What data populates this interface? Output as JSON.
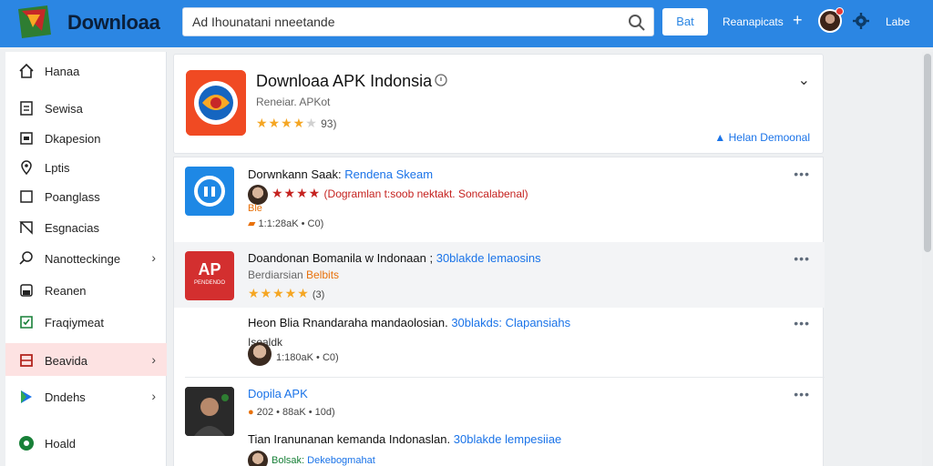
{
  "topbar": {
    "brand": "Downloaa",
    "search_value": "Ad  Ihounatani  nneetande",
    "button": "Bat",
    "link": "Reanapicats",
    "plus": "+",
    "right_label": "Labe",
    "colors": {
      "bar": "#2b86e3"
    }
  },
  "sidebar": {
    "items": [
      {
        "label": "Hanaa",
        "icon": "home-icon"
      },
      {
        "label": "Sewisa",
        "icon": "document-icon"
      },
      {
        "label": "Dkapesion",
        "icon": "window-icon"
      },
      {
        "label": "Lptis",
        "icon": "location-pin-icon"
      },
      {
        "label": "Poanglass",
        "icon": "square-icon"
      },
      {
        "label": "Esgnacias",
        "icon": "scale-icon",
        "chevron": false
      },
      {
        "label": "Nanotteckinge",
        "icon": "search-icon",
        "chevron": "›"
      },
      {
        "label": "Reanen",
        "icon": "bank-icon"
      },
      {
        "label": "Fraqiymeat",
        "icon": "shield-icon"
      },
      {
        "label": "Beavida",
        "icon": "grid-icon",
        "chevron": "›",
        "active": true
      },
      {
        "label": "Dndehs",
        "icon": "play-store-icon",
        "chevron": "›"
      },
      {
        "label": "Hoald",
        "icon": "green-status-icon"
      }
    ]
  },
  "header_card": {
    "title": "Downloaa APK Indonsia",
    "subtitle": "Reneiar.  APKot",
    "rating_count": "93)",
    "stars_on": "★★★★",
    "stars_off": "★",
    "link": "Helan Demoonal"
  },
  "rows": [
    {
      "title_a": "Dorwnkann  Saak: ",
      "title_b": "Rendena  Skeam",
      "line2": "(Dogramlan  t:soob nektakt.  Soncalabenal)",
      "line2_extra": "Ble",
      "line3": "1:1:28aK  •  C0)",
      "stars": "★★★★"
    },
    {
      "title_a": "Doandonan  Bomanila  w  Indonaan  ;  ",
      "title_b": "30blakde  lemaosins",
      "line2_a": "Berdiarsian  ",
      "line2_b": "Belbits",
      "line3": "(3)",
      "stars": "★★★★★",
      "icon_text": "AP",
      "icon_sub": "PENDENDO"
    },
    {
      "title_a": "Heon  Blia  Rnandaraha  mandaolosian.  ",
      "title_b": "30blakds:  Clapansiahs",
      "line2": "Isealdk",
      "line3": "1:180aK  •  C0)"
    },
    {
      "title_a": "Dopila  APK",
      "line2": "202  •  88aK  •  10d)",
      "title2_a": "Tian  Iranunanan  kemanda  Indonaslan.  ",
      "title2_b": "30blakde  lempesiiae",
      "line3_a": "Bolsak: ",
      "line3_b": "Dekebogmahat"
    }
  ]
}
